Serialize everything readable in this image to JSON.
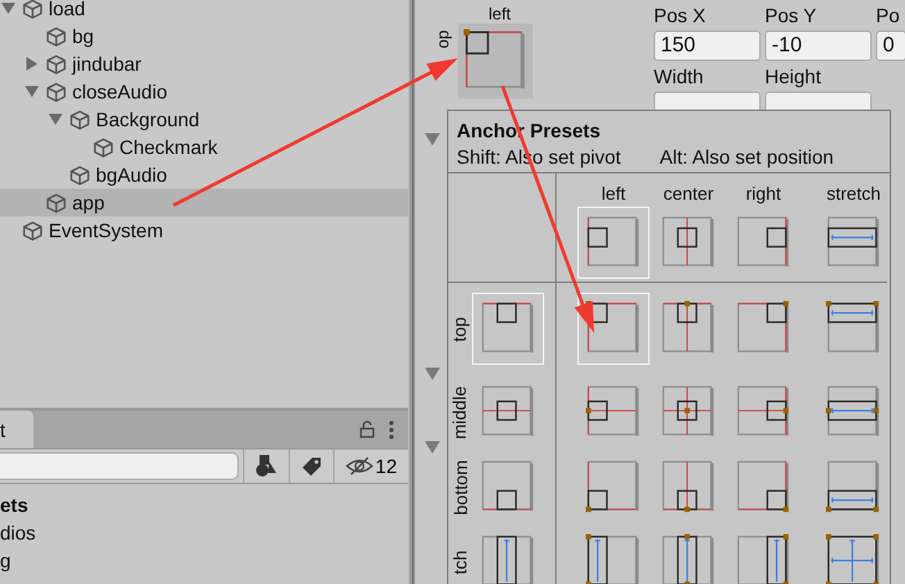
{
  "hierarchy": {
    "items": [
      {
        "label": "load",
        "kind": "expanded",
        "selected": false,
        "children": [
          {
            "label": "bg",
            "kind": "leaf",
            "selected": false
          },
          {
            "label": "jindubar",
            "kind": "collapsed",
            "selected": false
          },
          {
            "label": "closeAudio",
            "kind": "expanded",
            "selected": false,
            "children": [
              {
                "label": "Background",
                "kind": "expanded",
                "selected": false,
                "children": [
                  {
                    "label": "Checkmark",
                    "kind": "leaf",
                    "selected": false
                  }
                ]
              },
              {
                "label": "bgAudio",
                "kind": "leaf",
                "selected": false
              }
            ]
          },
          {
            "label": "app",
            "kind": "leaf",
            "selected": true
          }
        ]
      },
      {
        "label": "EventSystem",
        "kind": "leaf",
        "selected": false
      }
    ]
  },
  "project": {
    "tabs": [
      {
        "label": "t",
        "selected": true
      }
    ],
    "hidden_count": "12",
    "items": [
      {
        "label": "ets",
        "bold": true
      },
      {
        "label": "dios",
        "bold": false
      },
      {
        "label": "g",
        "bold": false
      }
    ]
  },
  "inspector": {
    "anchor": {
      "column_label": "left",
      "row_label": "op"
    },
    "fields": [
      {
        "label": "Pos X",
        "value": "150"
      },
      {
        "label": "Pos Y",
        "value": "-10"
      },
      {
        "label": "Po",
        "value": "0"
      },
      {
        "label": "Width"
      },
      {
        "label": "Height"
      }
    ]
  },
  "anchor_presets": {
    "title": "Anchor Presets",
    "hints": [
      "Shift: Also set pivot",
      "Alt: Also set position"
    ],
    "columns": [
      {
        "label": "left",
        "kind": "left",
        "selected": true
      },
      {
        "label": "center",
        "kind": "center",
        "selected": false
      },
      {
        "label": "right",
        "kind": "right",
        "selected": false
      },
      {
        "label": "stretch",
        "kind": "stretch",
        "selected": false
      }
    ],
    "rows": [
      {
        "label": "top",
        "kind": "top",
        "selected": true
      },
      {
        "label": "middle",
        "kind": "middle",
        "selected": false
      },
      {
        "label": "bottom",
        "kind": "bottom",
        "selected": false
      },
      {
        "label": "tch",
        "kind": "stretch",
        "selected": false
      }
    ]
  }
}
